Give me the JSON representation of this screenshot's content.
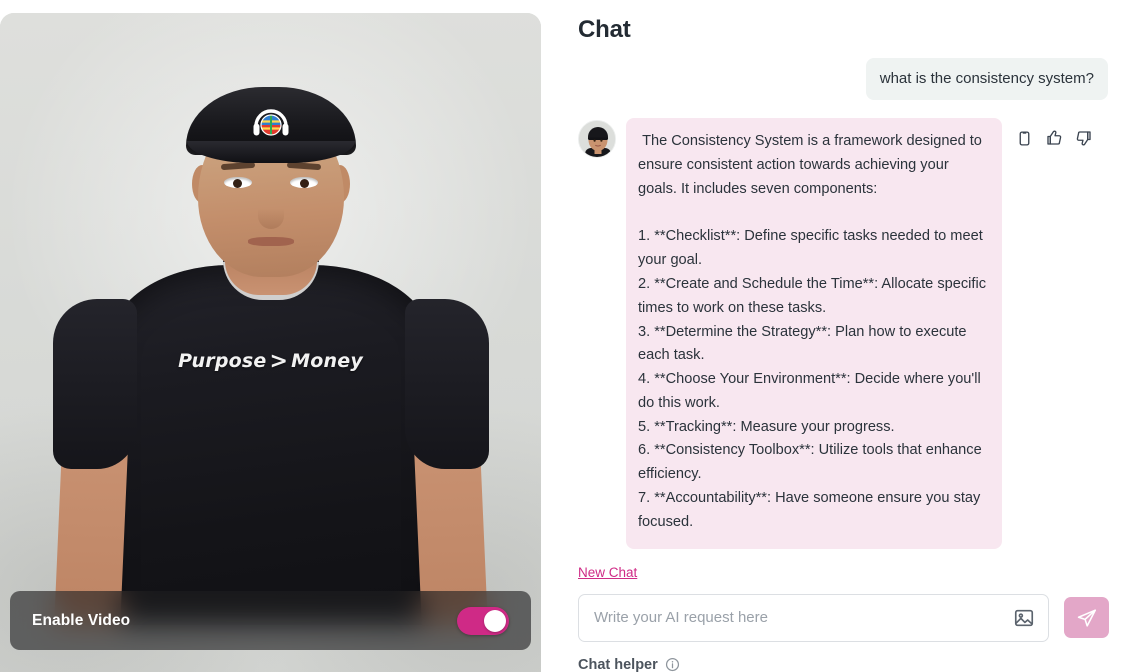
{
  "video": {
    "person": {
      "cap_logo": "globe-headphones-logo",
      "shirt_text_left": "Purpose",
      "shirt_text_symbol": ">",
      "shirt_text_right": "Money"
    },
    "control_bar": {
      "label": "Enable Video",
      "toggle_state": "on",
      "toggle_color": "#cf2a86"
    }
  },
  "chat": {
    "title": "Chat",
    "messages": [
      {
        "role": "user",
        "text": "what is the consistency system?"
      },
      {
        "role": "assistant",
        "avatar": "user-photo-avatar",
        "text": " The Consistency System is a framework designed to ensure consistent action towards achieving your goals. It includes seven components:\n\n1. **Checklist**: Define specific tasks needed to meet your goal.\n2. **Create and Schedule the Time**: Allocate specific times to work on these tasks.\n3. **Determine the Strategy**: Plan how to execute each task.\n4. **Choose Your Environment**: Decide where you'll do this work.\n5. **Tracking**: Measure your progress.\n6. **Consistency Toolbox**: Utilize tools that enhance efficiency.\n7. **Accountability**: Have someone ensure you stay focused.",
        "actions": [
          {
            "name": "copy-icon",
            "label": "Copy"
          },
          {
            "name": "thumbs-up-icon",
            "label": "Like"
          },
          {
            "name": "thumbs-down-icon",
            "label": "Dislike"
          }
        ]
      }
    ],
    "new_chat_label": "New Chat",
    "composer": {
      "value": "",
      "placeholder": "Write your AI request here",
      "attach_image_icon": "image-icon",
      "send_icon": "send-paper-plane-icon",
      "send_button_color": "#e3a7c8"
    },
    "helper": {
      "label": "Chat helper",
      "info_icon": "info-circle-icon"
    }
  },
  "colors": {
    "accent_pink": "#cf2a86",
    "user_bubble": "#eff3f2",
    "assistant_bubble": "#f8e7f0",
    "text_primary": "#2b333b"
  }
}
